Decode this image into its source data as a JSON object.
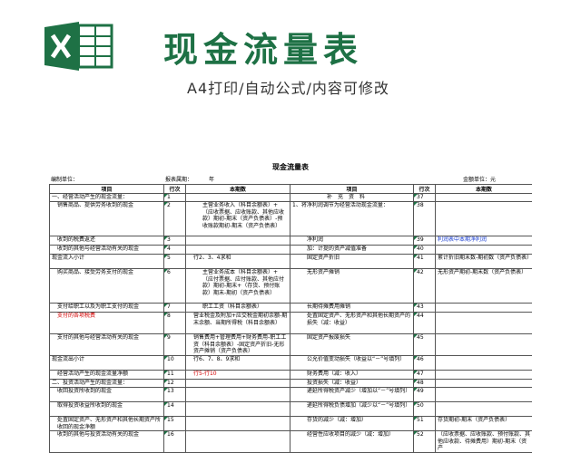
{
  "header": {
    "title": "现金流量表",
    "subtitle": "A4打印/自动公式/内容可修改"
  },
  "sheet": {
    "title": "现金流量表",
    "unit_label": "编制单位：",
    "period_label": "报表属期：",
    "year_label": "年",
    "currency_label": "金额单位：元",
    "columns": [
      "项目",
      "行次",
      "本期数",
      "项目",
      "行次",
      "本期数"
    ],
    "rows": [
      {
        "l_item": "一、经营活动产生的现金流量：",
        "l_no": "1",
        "l_val": "",
        "r_item": "补　充　资　料",
        "r_no": "37",
        "r_val": ""
      },
      {
        "l_item": "销售商品、提供劳务收到的现金",
        "l_no": "2",
        "l_val": "主营业务收入（科目余额表）+（应收票据、应收账款、其他应收款）期初-期末（资产负债表）-预收账款期初-期末（资产负债表）",
        "r_item": "1、将净利润调节为经营活动现金流量：",
        "r_no": "38",
        "r_val": ""
      },
      {
        "l_item": "收到的税费返还",
        "l_no": "3",
        "l_val": "",
        "r_item": "净利润",
        "r_no": "39",
        "r_val": "利润表中本期净利润"
      },
      {
        "l_item": "收到的其他与经营活动有关的现金",
        "l_no": "4",
        "l_val": "",
        "r_item": "加：计提的资产减值准备",
        "r_no": "40",
        "r_val": ""
      },
      {
        "l_item": "现金流入小计",
        "l_no": "5",
        "l_val": "行2、3、4求和",
        "r_item": "固定资产折旧",
        "r_no": "41",
        "r_val": "累计折旧期末数-期初数（资产负债表）"
      },
      {
        "l_item": "购买商品、接受劳务支付的现金",
        "l_no": "6",
        "l_val": "主营业务成本（科目余额表）+（应付票据、应付账款、其他应付款）期初-期末+（存货、预付账款）期末-期初（资产负债表）",
        "r_item": "无形资产摊销",
        "r_no": "42",
        "r_val": "无形资产期初-期末数（资产负债表）"
      },
      {
        "l_item": "支付给职工以及为职工支付的现金",
        "l_no": "7",
        "l_val": "职工工资（科目余额表）",
        "r_item": "长期待摊费用摊销",
        "r_no": "43",
        "r_val": ""
      },
      {
        "l_item": "支付的各项税费",
        "l_no": "8",
        "l_val": "营业税金及附加+应交税金期初余额-期末余额、当期所得税（科目余额表）",
        "r_item": "处置固定资产、无形资产和其他长期资产的损失（减：收益）",
        "r_no": "44",
        "r_val": ""
      },
      {
        "l_item": "支付的其他与经营活动有关的现金",
        "l_no": "9",
        "l_val": "销售费用+管理费用+财务费用-职工工资（科目余额表）-固定资产折旧-无形资产摊销（资产负债表）",
        "r_item": "固定资产报废损失",
        "r_no": "45",
        "r_val": ""
      },
      {
        "l_item": "现金流出小计",
        "l_no": "10",
        "l_val": "行6、7、8、9求和",
        "r_item": "公允价值变动损失（收益以“－”号填列）",
        "r_no": "46",
        "r_val": ""
      },
      {
        "l_item": "经营活动产生的现金流量净额",
        "l_no": "11",
        "l_val": "行5-行10",
        "r_item": "财务费用（减：收入）",
        "r_no": "47",
        "r_val": ""
      },
      {
        "l_item": "二、投资活动产生的现金流量：",
        "l_no": "12",
        "l_val": "",
        "r_item": "投资损失（减：收益）",
        "r_no": "48",
        "r_val": ""
      },
      {
        "l_item": "收回投资所收到的现金",
        "l_no": "13",
        "l_val": "",
        "r_item": "递延所得税资产减少（增加以“－”号填列）",
        "r_no": "49",
        "r_val": ""
      },
      {
        "l_item": "取得投资收益所收到的现金",
        "l_no": "14",
        "l_val": "",
        "r_item": "递延所得税负债增加（减少以“－”号填列）",
        "r_no": "50",
        "r_val": ""
      },
      {
        "l_item": "处置固定资产、无形资产和其他长期资产所收回的现金净额",
        "l_no": "15",
        "l_val": "",
        "r_item": "存货的减少（减：增加）",
        "r_no": "51",
        "r_val": "存货期初-期末（资产负债表）"
      },
      {
        "l_item": "收到的其他与投资活动有关的现金",
        "l_no": "16",
        "l_val": "",
        "r_item": "经营性应收项目的减少（减：增加）",
        "r_no": "52",
        "r_val": "（应收票据、应收账款、预付账款、其他应收款、待摊费用）期初-期末（资产"
      }
    ]
  }
}
